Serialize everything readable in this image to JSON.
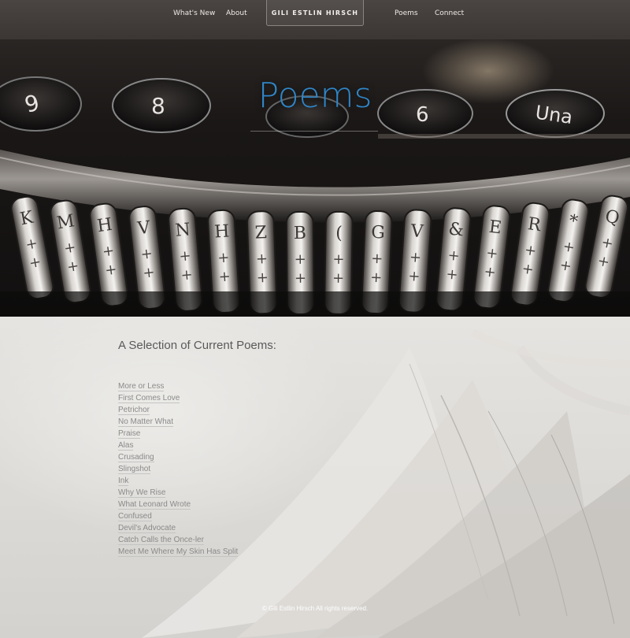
{
  "nav": {
    "items_left": [
      "What's New",
      "About"
    ],
    "brand": "GILI ESTLIN HIRSCH",
    "items_right": [
      "Poems",
      "Connect"
    ]
  },
  "hero": {
    "title": "Poems",
    "typebars": [
      "K",
      "M",
      "H",
      "V",
      "N",
      "H",
      "Z",
      "B",
      "(",
      "G",
      "V",
      "&",
      "E",
      "R",
      "*",
      "Q"
    ],
    "keys": [
      "9",
      "8",
      "?",
      "6",
      "Una"
    ]
  },
  "main": {
    "section_title": "A Selection of Current Poems:",
    "poems": [
      "More or Less",
      "First Comes Love",
      "Petrichor",
      "No Matter What",
      "Praise",
      "Alas",
      "Crusading",
      "Slingshot",
      "Ink",
      "Why We Rise",
      "What Leonard Wrote",
      "Confused",
      "Devil's Advocate",
      "Catch Calls the Once-ler",
      "Meet Me Where My Skin Has Split"
    ]
  },
  "footer": {
    "text": "© Gili Estlin Hirsch All rights reserved."
  }
}
